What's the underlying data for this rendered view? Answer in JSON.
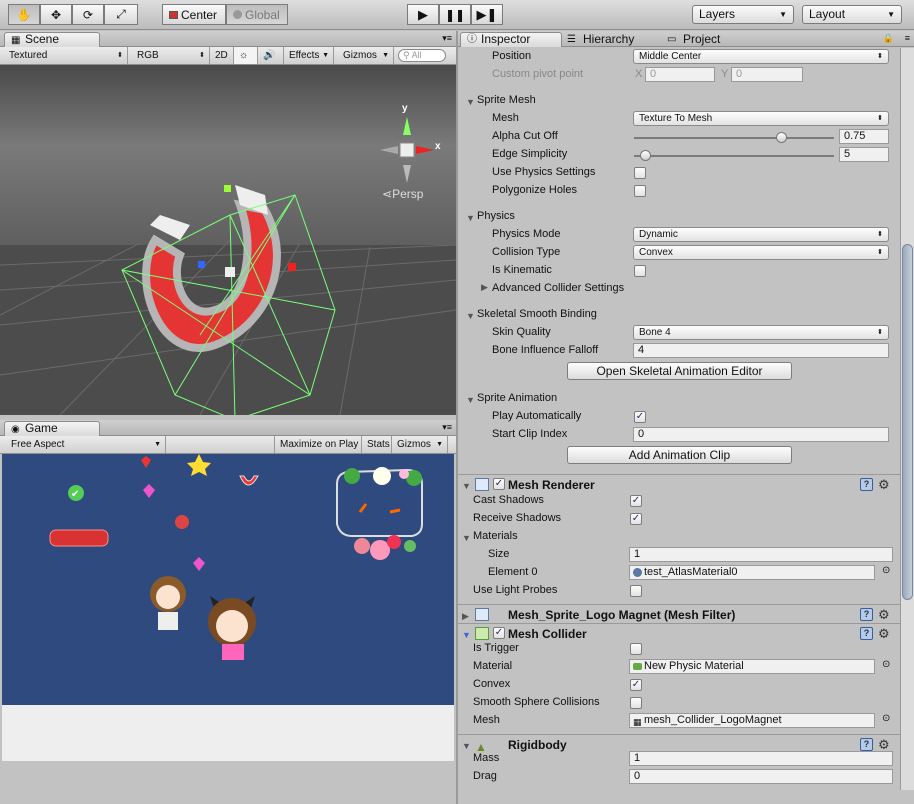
{
  "toolbar": {
    "pivot_center": "Center",
    "pivot_global": "Global",
    "layers": "Layers",
    "layout": "Layout"
  },
  "scene": {
    "tab": "Scene",
    "render_mode": "Textured",
    "color_mode": "RGB",
    "mode_2d": "2D",
    "effects": "Effects",
    "gizmos": "Gizmos",
    "search_placeholder": "All",
    "persp": "Persp",
    "axis_x": "x",
    "axis_y": "y"
  },
  "game": {
    "tab": "Game",
    "aspect": "Free Aspect",
    "maximize": "Maximize on Play",
    "stats": "Stats",
    "gizmos": "Gizmos"
  },
  "inspector": {
    "tabs": [
      "Inspector",
      "Hierarchy",
      "Project"
    ],
    "position_label": "Position",
    "position_value": "Middle Center",
    "pivot_label": "Custom pivot point",
    "pivot_x_label": "X",
    "pivot_x": "0",
    "pivot_y_label": "Y",
    "pivot_y": "0",
    "sprite_mesh": {
      "header": "Sprite Mesh",
      "mesh_label": "Mesh",
      "mesh_value": "Texture To Mesh",
      "alpha_label": "Alpha Cut Off",
      "alpha_value": "0.75",
      "alpha_fraction": 0.75,
      "edge_label": "Edge Simplicity",
      "edge_value": "5",
      "edge_fraction": 0.03,
      "use_physics_label": "Use Physics Settings",
      "use_physics": false,
      "polygonize_label": "Polygonize Holes",
      "polygonize": false
    },
    "physics": {
      "header": "Physics",
      "mode_label": "Physics Mode",
      "mode_value": "Dynamic",
      "collision_label": "Collision Type",
      "collision_value": "Convex",
      "kinematic_label": "Is Kinematic",
      "kinematic": false,
      "advanced_label": "Advanced Collider Settings"
    },
    "skeletal": {
      "header": "Skeletal Smooth Binding",
      "quality_label": "Skin Quality",
      "quality_value": "Bone 4",
      "falloff_label": "Bone Influence Falloff",
      "falloff_value": "4",
      "editor_button": "Open Skeletal Animation Editor"
    },
    "animation": {
      "header": "Sprite Animation",
      "play_label": "Play Automatically",
      "play": true,
      "start_label": "Start Clip Index",
      "start_value": "0",
      "add_button": "Add Animation Clip"
    },
    "mesh_renderer": {
      "title": "Mesh Renderer",
      "cast_label": "Cast Shadows",
      "cast": true,
      "receive_label": "Receive Shadows",
      "receive": true,
      "materials_label": "Materials",
      "size_label": "Size",
      "size_value": "1",
      "element_label": "Element 0",
      "element_value": "test_AtlasMaterial0",
      "probes_label": "Use Light Probes",
      "probes": false
    },
    "mesh_filter": {
      "title": "Mesh_Sprite_Logo Magnet (Mesh Filter)"
    },
    "mesh_collider": {
      "title": "Mesh Collider",
      "trigger_label": "Is Trigger",
      "trigger": false,
      "material_label": "Material",
      "material_value": "New Physic Material",
      "convex_label": "Convex",
      "convex": true,
      "smooth_label": "Smooth Sphere Collisions",
      "smooth": false,
      "mesh_label": "Mesh",
      "mesh_value": "mesh_Collider_LogoMagnet"
    },
    "rigidbody": {
      "title": "Rigidbody",
      "mass_label": "Mass",
      "mass_value": "1",
      "drag_label": "Drag",
      "drag_value": "0"
    }
  }
}
